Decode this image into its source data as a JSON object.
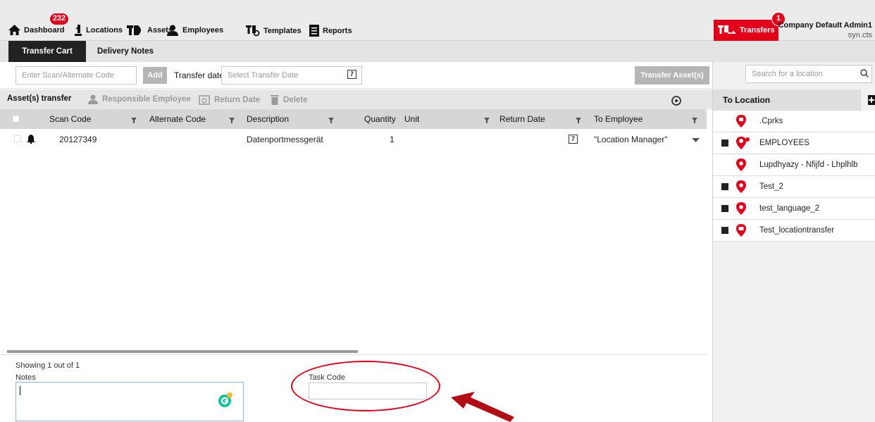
{
  "nav": {
    "dashboard": "Dashboard",
    "dashboard_badge": "232",
    "locations": "Locations",
    "assets": "Assets",
    "employees": "Employees",
    "templates": "Templates",
    "reports": "Reports",
    "transfers": "Transfers",
    "transfers_badge": "1",
    "user_name": "Company Default Admin1",
    "user_sub": "syn.cts"
  },
  "tabs": {
    "transfer_cart": "Transfer Cart",
    "delivery_notes": "Delivery Notes"
  },
  "actions": {
    "scan_placeholder": "Enter Scan/Alternate Code",
    "add": "Add",
    "transfer_date_label": "Transfer date",
    "transfer_date_placeholder": "Select Transfer Date",
    "date_icon": "7",
    "transfer_assets": "Transfer Asset(s)"
  },
  "toolbar": {
    "assets_transfer": "Asset(s) transfer",
    "responsible_employee": "Responsible Employee",
    "return_date": "Return Date",
    "delete": "Delete"
  },
  "grid": {
    "columns": [
      "Scan Code",
      "Alternate Code",
      "Description",
      "Quantity",
      "Unit",
      "Return Date",
      "To Employee"
    ],
    "rows": [
      {
        "scan_code": "20127349",
        "alternate_code": "",
        "description": "Datenportmessgerät",
        "quantity": "1",
        "unit": "",
        "return_date_icon": "7",
        "to_employee": "\"Location Manager\""
      }
    ]
  },
  "footer": {
    "showing": "Showing 1 out of 1",
    "notes_label": "Notes",
    "task_code_label": "Task Code"
  },
  "right_panel": {
    "search_placeholder": "Search for a location",
    "header": "To Location",
    "locations": [
      {
        "label": ".Cprks",
        "expandable": false
      },
      {
        "label": "EMPLOYEES",
        "expandable": true
      },
      {
        "label": "Lupdhyazy - Nfijfd - Lhplhlb",
        "expandable": false
      },
      {
        "label": "Test_2",
        "expandable": true
      },
      {
        "label": "test_language_2",
        "expandable": true
      },
      {
        "label": "Test_locationtransfer",
        "expandable": true
      }
    ]
  },
  "colors": {
    "brand_red": "#e2001a",
    "dark": "#222222"
  }
}
